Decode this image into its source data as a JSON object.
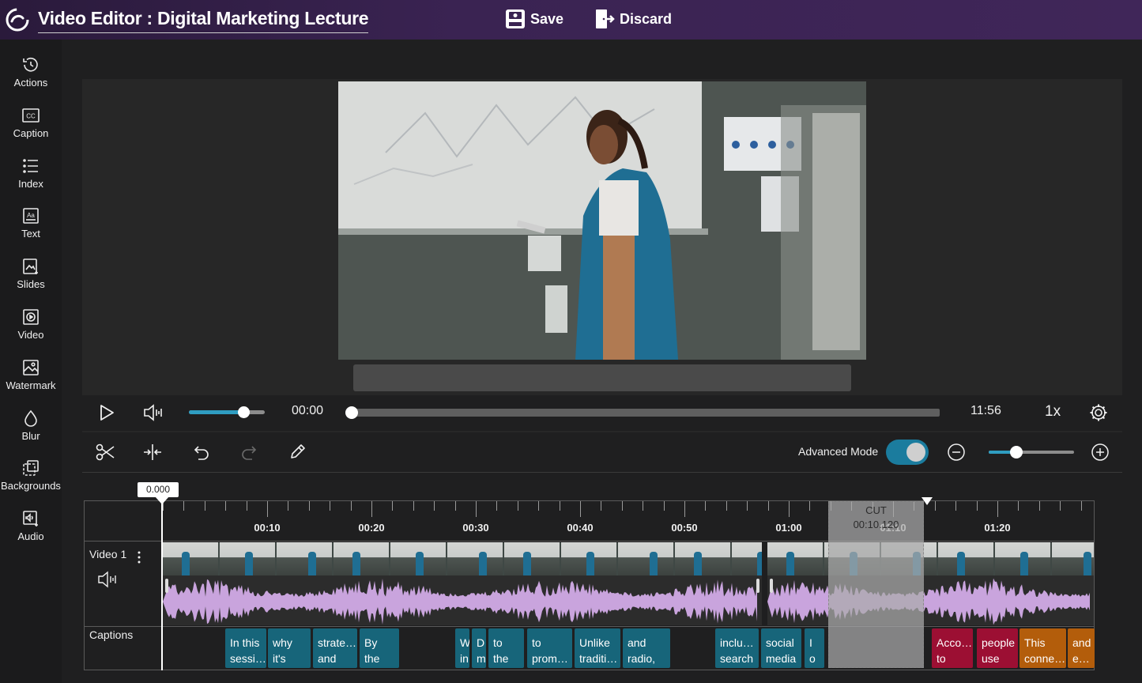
{
  "header": {
    "title": "Video Editor : Digital Marketing Lecture",
    "save_label": "Save",
    "discard_label": "Discard"
  },
  "sidebar": {
    "items": [
      {
        "label": "Actions",
        "icon": "history-icon"
      },
      {
        "label": "Caption",
        "icon": "cc-icon"
      },
      {
        "label": "Index",
        "icon": "list-icon"
      },
      {
        "label": "Text",
        "icon": "text-aa-icon"
      },
      {
        "label": "Slides",
        "icon": "slides-icon"
      },
      {
        "label": "Video",
        "icon": "video-play-icon"
      },
      {
        "label": "Watermark",
        "icon": "image-icon"
      },
      {
        "label": "Blur",
        "icon": "droplet-icon"
      },
      {
        "label": "Backgrounds",
        "icon": "backgrounds-icon"
      },
      {
        "label": "Audio",
        "icon": "audio-icon"
      }
    ]
  },
  "player": {
    "current_time": "00:00",
    "total_time": "11:56",
    "speed": "1x",
    "volume_level": 0.72,
    "seek_progress": 0.0
  },
  "toolbar": {
    "advanced_mode_label": "Advanced Mode",
    "advanced_mode_on": true,
    "zoom_level": 0.32
  },
  "timeline": {
    "playhead_value": "0.000",
    "tick_labels": [
      "00:10",
      "00:20",
      "00:30",
      "00:40",
      "00:50",
      "01:00",
      "01:10",
      "01:20"
    ],
    "tracks": {
      "video_label": "Video 1",
      "captions_label": "Captions"
    },
    "cut": {
      "label": "CUT",
      "time": "00:10.120"
    },
    "captions": [
      {
        "l1": "In this",
        "l2": "session",
        "color": "teal"
      },
      {
        "l1": "why",
        "l2": "it's",
        "color": "teal"
      },
      {
        "l1": "strategies",
        "l2": "and",
        "color": "teal"
      },
      {
        "l1": "By",
        "l2": "the",
        "color": "teal"
      },
      {
        "l1": "W",
        "l2": "in",
        "color": "teal"
      },
      {
        "l1": "D",
        "l2": "m",
        "color": "teal"
      },
      {
        "l1": "to",
        "l2": "the",
        "color": "teal"
      },
      {
        "l1": "to",
        "l2": "promote",
        "color": "teal"
      },
      {
        "l1": "Unlike",
        "l2": "traditional",
        "color": "teal"
      },
      {
        "l1": "and",
        "l2": "radio,",
        "color": "teal"
      },
      {
        "l1": "including",
        "l2": "search",
        "color": "teal"
      },
      {
        "l1": "social",
        "l2": "media",
        "color": "teal"
      },
      {
        "l1": "I",
        "l2": "o",
        "color": "teal"
      },
      {
        "l1": "According",
        "l2": "to",
        "color": "red"
      },
      {
        "l1": "people",
        "l2": "use",
        "color": "red"
      },
      {
        "l1": "This",
        "l2": "connects",
        "color": "orange"
      },
      {
        "l1": "and",
        "l2": "engage",
        "color": "orange"
      }
    ]
  },
  "colors": {
    "accent": "#2f9dc1",
    "caption_teal": "#17657a",
    "caption_red": "#9c0f33",
    "caption_orange": "#b35d0b",
    "waveform": "#c9a4dd"
  }
}
